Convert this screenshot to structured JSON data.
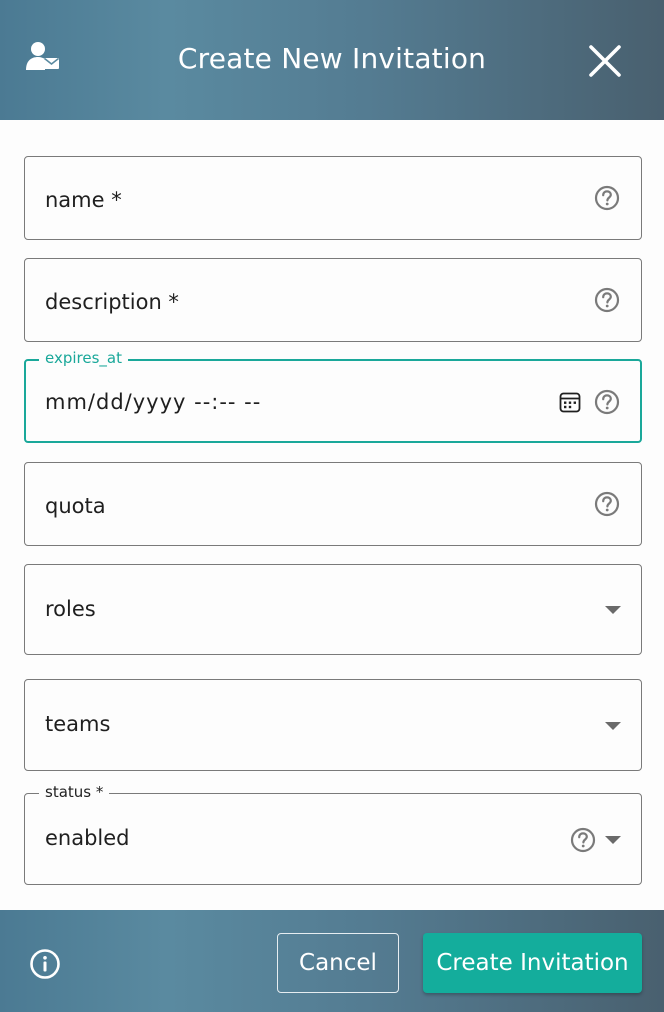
{
  "dialog": {
    "title": "Create New Invitation",
    "header_icon": "user-envelope-icon",
    "close_icon": "close-icon"
  },
  "fields": {
    "name": {
      "label": "name *",
      "icon": "help-circle-icon"
    },
    "description": {
      "label": "description *",
      "icon": "help-circle-icon"
    },
    "expires_at": {
      "legend": "expires_at",
      "placeholder": "mm/dd/yyyy --:-- --",
      "icons": [
        "calendar-icon",
        "help-circle-icon"
      ]
    },
    "quota": {
      "label": "quota",
      "icon": "help-circle-icon"
    },
    "roles": {
      "label": "roles",
      "icon": "caret-down-icon"
    },
    "teams": {
      "label": "teams",
      "icon": "caret-down-icon"
    },
    "status": {
      "legend": "status *",
      "value": "enabled",
      "icons": [
        "help-circle-icon",
        "caret-down-icon"
      ]
    }
  },
  "footer": {
    "info_icon": "info-icon",
    "cancel_label": "Cancel",
    "create_label": "Create Invitation"
  },
  "colors": {
    "accent": "#14ad9c",
    "focus_border": "#1aa89a",
    "header_gradient": [
      "#4b7a93",
      "#5a8aa0",
      "#49606f"
    ],
    "text": "#1f1f1f",
    "icon_gray": "#7a7a7a"
  }
}
